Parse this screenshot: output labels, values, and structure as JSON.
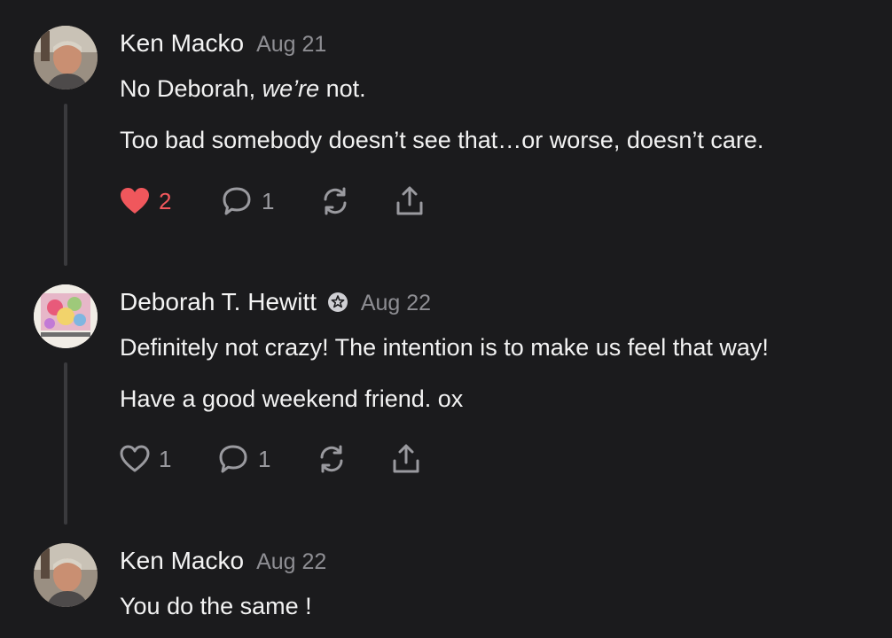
{
  "comments": [
    {
      "author": "Ken Macko",
      "date": "Aug 21",
      "lines": [
        "No Deborah, ",
        "we’re",
        " not."
      ],
      "line2": "Too bad somebody doesn’t see that…or worse, doesn’t care.",
      "likes": "2",
      "replies": "1",
      "liked": true
    },
    {
      "author": "Deborah T. Hewitt",
      "date": "Aug 22",
      "line1": "Definitely not crazy! The intention is to make us feel that way!",
      "line2": "Have a good weekend friend. ox",
      "likes": "1",
      "replies": "1",
      "liked": false
    },
    {
      "author": "Ken Macko",
      "date": "Aug 22",
      "line1": "You do the same !"
    }
  ],
  "colors": {
    "background": "#1b1b1d",
    "like": "#f0575c",
    "muted": "#8e8e93"
  },
  "icons": [
    "heart-icon",
    "comment-bubble-icon",
    "restack-icon",
    "share-icon",
    "founding-member-badge-icon"
  ]
}
